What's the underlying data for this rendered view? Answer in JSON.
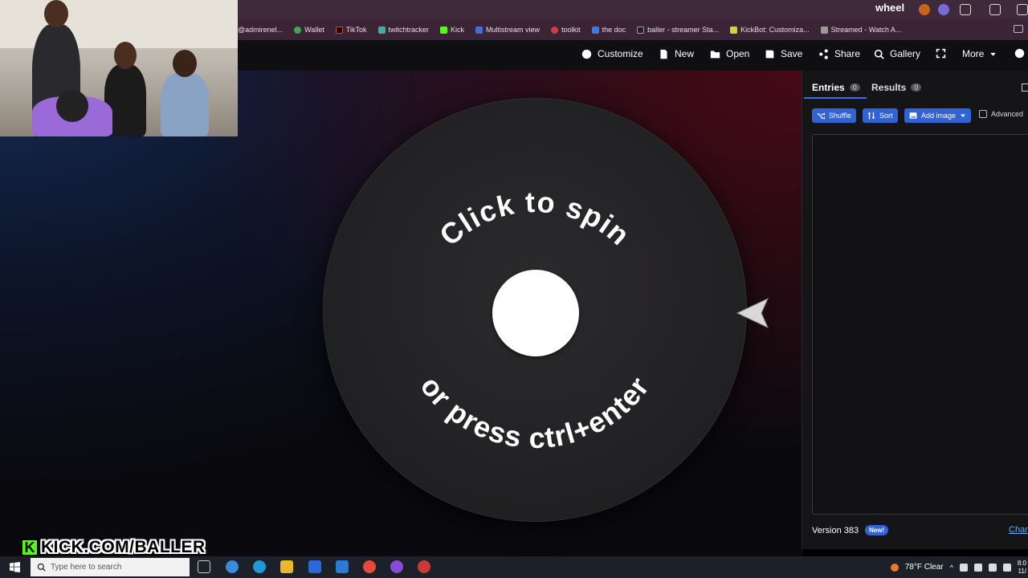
{
  "browser": {
    "tab_title": "wheel",
    "bookmarks": [
      {
        "label": "@admirenel...",
        "icon": "mail-icon"
      },
      {
        "label": "Wallet",
        "icon": "wallet-icon"
      },
      {
        "label": "TikTok",
        "icon": "tiktok-icon"
      },
      {
        "label": "twitchtracker",
        "icon": "twitchtracker-icon"
      },
      {
        "label": "Kick",
        "icon": "kick-icon"
      },
      {
        "label": "Multistream view",
        "icon": "multistream-icon"
      },
      {
        "label": "toolkit",
        "icon": "toolkit-icon"
      },
      {
        "label": "the doc",
        "icon": "doc-icon"
      },
      {
        "label": "baller - streamer Sta...",
        "icon": "streamer-icon"
      },
      {
        "label": "KickBot: Customiza...",
        "icon": "kickbot-icon"
      },
      {
        "label": "Streamed - Watch A...",
        "icon": "streamed-icon"
      }
    ]
  },
  "toolbar": {
    "customize": "Customize",
    "new": "New",
    "open": "Open",
    "save": "Save",
    "share": "Share",
    "gallery": "Gallery",
    "more": "More"
  },
  "wheel": {
    "top_text": "Click to spin",
    "bottom_text": "or press ctrl+enter"
  },
  "panel": {
    "tabs": [
      {
        "label": "Entries",
        "count": "0"
      },
      {
        "label": "Results",
        "count": "0"
      }
    ],
    "shuffle": "Shuffle",
    "sort": "Sort",
    "add_image": "Add image",
    "advanced": "Advanced",
    "version": "Version 383",
    "new_badge": "New!",
    "changelog": "Chan"
  },
  "overlay": {
    "kick_text": "KICK.COM/BALLER"
  },
  "taskbar": {
    "search_placeholder": "Type here to search",
    "weather": "78°F  Clear",
    "time": "8:0",
    "date": "11/"
  },
  "colors": {
    "accent": "#2f63d6",
    "kick_green": "#53fc18",
    "panel_bg": "#151518"
  }
}
